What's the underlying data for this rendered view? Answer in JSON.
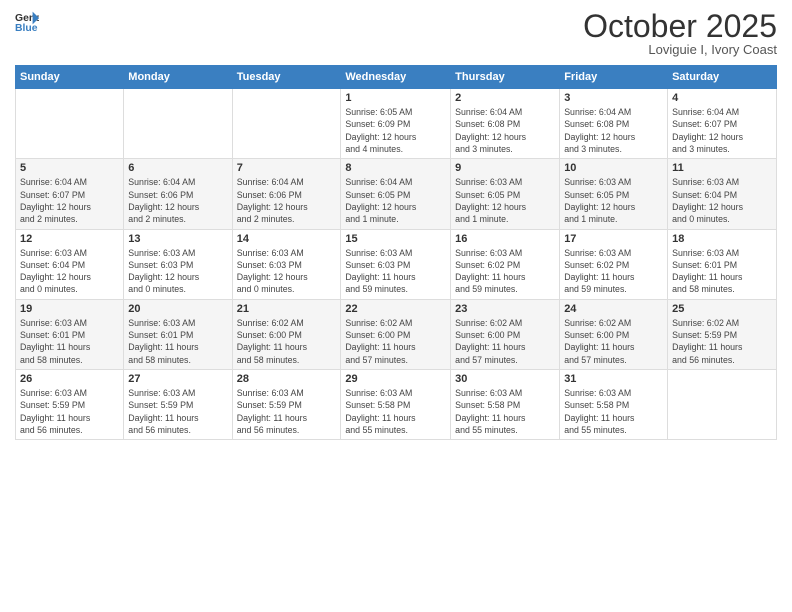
{
  "logo": {
    "line1": "General",
    "line2": "Blue"
  },
  "title": "October 2025",
  "location": "Loviguie I, Ivory Coast",
  "days_header": [
    "Sunday",
    "Monday",
    "Tuesday",
    "Wednesday",
    "Thursday",
    "Friday",
    "Saturday"
  ],
  "weeks": [
    [
      {
        "day": "",
        "detail": ""
      },
      {
        "day": "",
        "detail": ""
      },
      {
        "day": "",
        "detail": ""
      },
      {
        "day": "1",
        "detail": "Sunrise: 6:05 AM\nSunset: 6:09 PM\nDaylight: 12 hours\nand 4 minutes."
      },
      {
        "day": "2",
        "detail": "Sunrise: 6:04 AM\nSunset: 6:08 PM\nDaylight: 12 hours\nand 3 minutes."
      },
      {
        "day": "3",
        "detail": "Sunrise: 6:04 AM\nSunset: 6:08 PM\nDaylight: 12 hours\nand 3 minutes."
      },
      {
        "day": "4",
        "detail": "Sunrise: 6:04 AM\nSunset: 6:07 PM\nDaylight: 12 hours\nand 3 minutes."
      }
    ],
    [
      {
        "day": "5",
        "detail": "Sunrise: 6:04 AM\nSunset: 6:07 PM\nDaylight: 12 hours\nand 2 minutes."
      },
      {
        "day": "6",
        "detail": "Sunrise: 6:04 AM\nSunset: 6:06 PM\nDaylight: 12 hours\nand 2 minutes."
      },
      {
        "day": "7",
        "detail": "Sunrise: 6:04 AM\nSunset: 6:06 PM\nDaylight: 12 hours\nand 2 minutes."
      },
      {
        "day": "8",
        "detail": "Sunrise: 6:04 AM\nSunset: 6:05 PM\nDaylight: 12 hours\nand 1 minute."
      },
      {
        "day": "9",
        "detail": "Sunrise: 6:03 AM\nSunset: 6:05 PM\nDaylight: 12 hours\nand 1 minute."
      },
      {
        "day": "10",
        "detail": "Sunrise: 6:03 AM\nSunset: 6:05 PM\nDaylight: 12 hours\nand 1 minute."
      },
      {
        "day": "11",
        "detail": "Sunrise: 6:03 AM\nSunset: 6:04 PM\nDaylight: 12 hours\nand 0 minutes."
      }
    ],
    [
      {
        "day": "12",
        "detail": "Sunrise: 6:03 AM\nSunset: 6:04 PM\nDaylight: 12 hours\nand 0 minutes."
      },
      {
        "day": "13",
        "detail": "Sunrise: 6:03 AM\nSunset: 6:03 PM\nDaylight: 12 hours\nand 0 minutes."
      },
      {
        "day": "14",
        "detail": "Sunrise: 6:03 AM\nSunset: 6:03 PM\nDaylight: 12 hours\nand 0 minutes."
      },
      {
        "day": "15",
        "detail": "Sunrise: 6:03 AM\nSunset: 6:03 PM\nDaylight: 11 hours\nand 59 minutes."
      },
      {
        "day": "16",
        "detail": "Sunrise: 6:03 AM\nSunset: 6:02 PM\nDaylight: 11 hours\nand 59 minutes."
      },
      {
        "day": "17",
        "detail": "Sunrise: 6:03 AM\nSunset: 6:02 PM\nDaylight: 11 hours\nand 59 minutes."
      },
      {
        "day": "18",
        "detail": "Sunrise: 6:03 AM\nSunset: 6:01 PM\nDaylight: 11 hours\nand 58 minutes."
      }
    ],
    [
      {
        "day": "19",
        "detail": "Sunrise: 6:03 AM\nSunset: 6:01 PM\nDaylight: 11 hours\nand 58 minutes."
      },
      {
        "day": "20",
        "detail": "Sunrise: 6:03 AM\nSunset: 6:01 PM\nDaylight: 11 hours\nand 58 minutes."
      },
      {
        "day": "21",
        "detail": "Sunrise: 6:02 AM\nSunset: 6:00 PM\nDaylight: 11 hours\nand 58 minutes."
      },
      {
        "day": "22",
        "detail": "Sunrise: 6:02 AM\nSunset: 6:00 PM\nDaylight: 11 hours\nand 57 minutes."
      },
      {
        "day": "23",
        "detail": "Sunrise: 6:02 AM\nSunset: 6:00 PM\nDaylight: 11 hours\nand 57 minutes."
      },
      {
        "day": "24",
        "detail": "Sunrise: 6:02 AM\nSunset: 6:00 PM\nDaylight: 11 hours\nand 57 minutes."
      },
      {
        "day": "25",
        "detail": "Sunrise: 6:02 AM\nSunset: 5:59 PM\nDaylight: 11 hours\nand 56 minutes."
      }
    ],
    [
      {
        "day": "26",
        "detail": "Sunrise: 6:03 AM\nSunset: 5:59 PM\nDaylight: 11 hours\nand 56 minutes."
      },
      {
        "day": "27",
        "detail": "Sunrise: 6:03 AM\nSunset: 5:59 PM\nDaylight: 11 hours\nand 56 minutes."
      },
      {
        "day": "28",
        "detail": "Sunrise: 6:03 AM\nSunset: 5:59 PM\nDaylight: 11 hours\nand 56 minutes."
      },
      {
        "day": "29",
        "detail": "Sunrise: 6:03 AM\nSunset: 5:58 PM\nDaylight: 11 hours\nand 55 minutes."
      },
      {
        "day": "30",
        "detail": "Sunrise: 6:03 AM\nSunset: 5:58 PM\nDaylight: 11 hours\nand 55 minutes."
      },
      {
        "day": "31",
        "detail": "Sunrise: 6:03 AM\nSunset: 5:58 PM\nDaylight: 11 hours\nand 55 minutes."
      },
      {
        "day": "",
        "detail": ""
      }
    ]
  ]
}
